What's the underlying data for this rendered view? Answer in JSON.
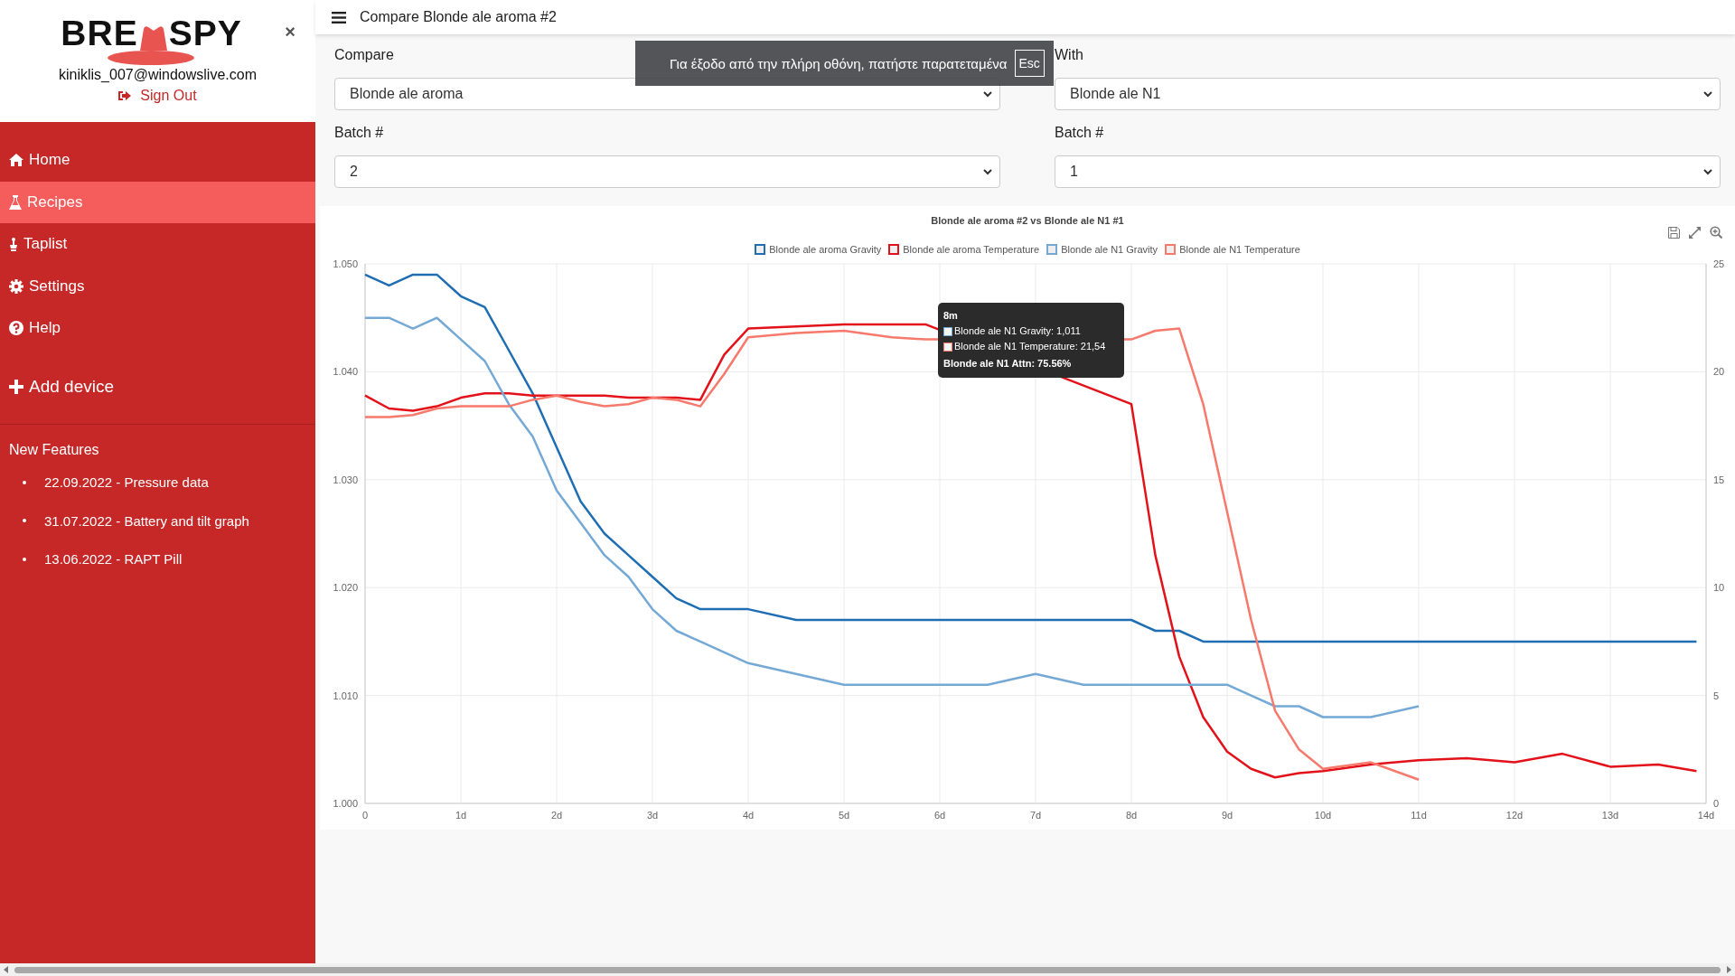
{
  "sidebar": {
    "logo": {
      "left": "BRE",
      "right": "SPY"
    },
    "close": "×",
    "user_email": "kiniklis_007@windowslive.com",
    "sign_out": "Sign Out",
    "nav": [
      {
        "kind": "link",
        "label": "Home",
        "selected": false
      },
      {
        "kind": "link",
        "label": "Recipes",
        "selected": true
      },
      {
        "kind": "link",
        "label": "Taplist",
        "selected": false
      },
      {
        "kind": "link",
        "label": "Settings",
        "selected": false
      },
      {
        "kind": "link",
        "label": "Help",
        "selected": false
      },
      {
        "kind": "action",
        "label": "Add device",
        "selected": false
      }
    ],
    "features_title": "New Features",
    "features": [
      "22.09.2022 - Pressure data",
      "31.07.2022 - Battery and tilt graph",
      "13.06.2022 - RAPT Pill"
    ]
  },
  "topbar": {
    "title": "Compare Blonde ale aroma #2"
  },
  "form": {
    "fields": [
      {
        "label": "Compare",
        "value": "Blonde ale aroma"
      },
      {
        "label": "With",
        "value": "Blonde ale N1"
      },
      {
        "label": "Batch #",
        "value": "2"
      },
      {
        "label": "Batch #",
        "value": "1"
      }
    ]
  },
  "chart": {
    "chart_data": {
      "type": "line",
      "title": "Blonde ale aroma #2 vs Blonde ale N1 #1",
      "x": [
        0,
        0.25,
        0.5,
        0.75,
        1,
        1.25,
        1.5,
        1.75,
        2,
        2.25,
        2.5,
        2.75,
        3,
        3.25,
        3.5,
        3.75,
        4,
        4.5,
        5,
        5.5,
        5.85,
        6.5,
        7,
        7.5,
        7.75,
        8,
        8.25,
        8.5,
        8.75,
        9,
        9.25,
        9.5,
        9.75,
        10,
        10.5,
        11,
        11.5,
        12,
        12.5,
        13,
        13.5,
        13.9
      ],
      "series": [
        {
          "name": "Blonde ale aroma Gravity",
          "color": "#1f6eb3",
          "values": [
            1.049,
            1.048,
            1.049,
            1.049,
            1.047,
            1.046,
            1.042,
            1.038,
            1.033,
            1.028,
            1.025,
            1.023,
            1.021,
            1.019,
            1.018,
            1.018,
            1.018,
            1.017,
            1.017,
            1.017,
            1.017,
            1.017,
            1.017,
            1.017,
            1.017,
            1.017,
            1.016,
            1.016,
            1.015,
            1.015,
            1.015,
            1.015,
            1.015,
            1.015,
            1.015,
            1.015,
            1.015,
            1.015,
            1.015,
            1.015,
            1.015,
            1.015
          ]
        },
        {
          "name": "Blonde ale aroma Temperature",
          "color": "#e3121a",
          "axis": "y2",
          "values": [
            18.9,
            18.3,
            18.2,
            18.4,
            18.8,
            19.0,
            19.0,
            18.9,
            18.9,
            18.9,
            18.9,
            18.8,
            18.8,
            18.8,
            18.7,
            20.8,
            22.0,
            22.1,
            22.2,
            22.2,
            22.2,
            null,
            null,
            null,
            null,
            18.5,
            11.5,
            6.8,
            4.0,
            2.4,
            1.6,
            1.2,
            1.4,
            1.5,
            1.8,
            2.0,
            2.1,
            1.9,
            2.3,
            1.7,
            1.8,
            1.5
          ]
        },
        {
          "name": "Blonde ale N1 Gravity",
          "color": "#74a9d6",
          "values": [
            1.045,
            1.045,
            1.044,
            1.045,
            1.043,
            1.041,
            1.037,
            1.034,
            1.029,
            1.026,
            1.023,
            1.021,
            1.018,
            1.016,
            1.015,
            1.014,
            1.013,
            1.012,
            1.011,
            1.011,
            1.011,
            1.011,
            1.012,
            1.011,
            1.011,
            1.011,
            1.011,
            1.011,
            1.011,
            1.011,
            1.01,
            1.009,
            1.009,
            1.008,
            1.008,
            1.009,
            null,
            null,
            null,
            null,
            null,
            null
          ]
        },
        {
          "name": "Blonde ale N1 Temperature",
          "color": "#f7796c",
          "axis": "y2",
          "values": [
            17.9,
            17.9,
            18.0,
            18.3,
            18.4,
            18.4,
            18.4,
            18.7,
            18.9,
            18.6,
            18.4,
            18.5,
            18.8,
            18.7,
            18.4,
            19.9,
            21.6,
            21.8,
            21.9,
            21.6,
            21.5,
            null,
            null,
            null,
            null,
            21.5,
            21.9,
            22.0,
            18.5,
            13.5,
            8.5,
            4.3,
            2.5,
            1.6,
            1.9,
            1.1,
            null,
            null,
            null,
            null,
            null,
            null
          ]
        }
      ],
      "grid": true,
      "xlim": [
        0,
        14
      ],
      "ylim": [
        1.0,
        1.05
      ],
      "y2lim": [
        0,
        25
      ],
      "xticks": [
        {
          "value": 0,
          "label": "0"
        },
        {
          "value": 1,
          "label": "1d"
        },
        {
          "value": 2,
          "label": "2d"
        },
        {
          "value": 3,
          "label": "3d"
        },
        {
          "value": 4,
          "label": "4d"
        },
        {
          "value": 5,
          "label": "5d"
        },
        {
          "value": 6,
          "label": "6d"
        },
        {
          "value": 7,
          "label": "7d"
        },
        {
          "value": 8,
          "label": "8d"
        },
        {
          "value": 9,
          "label": "9d"
        },
        {
          "value": 10,
          "label": "10d"
        },
        {
          "value": 11,
          "label": "11d"
        },
        {
          "value": 12,
          "label": "12d"
        },
        {
          "value": 13,
          "label": "13d"
        },
        {
          "value": 14,
          "label": "14d"
        }
      ],
      "yticks": [
        {
          "value": 1.0,
          "label": "1.000"
        },
        {
          "value": 1.01,
          "label": "1.010"
        },
        {
          "value": 1.02,
          "label": "1.020"
        },
        {
          "value": 1.03,
          "label": "1.030"
        },
        {
          "value": 1.04,
          "label": "1.040"
        },
        {
          "value": 1.05,
          "label": "1.050"
        }
      ],
      "y2ticks": [
        0,
        5,
        10,
        15,
        20,
        25
      ]
    },
    "tooltip": {
      "title": "8m",
      "items": [
        {
          "text": "Blonde ale N1 Gravity: 1,011",
          "color": "#74a9d6"
        },
        {
          "text": "Blonde ale N1 Temperature: 21,54",
          "color": "#f7796c"
        }
      ],
      "footer": "Blonde ale N1 Attn: 75.56%"
    }
  },
  "fullscreen_notice": {
    "text": "Για έξοδο από την πλήρη οθόνη, πατήστε παρατεταμένα",
    "key": "Esc"
  }
}
